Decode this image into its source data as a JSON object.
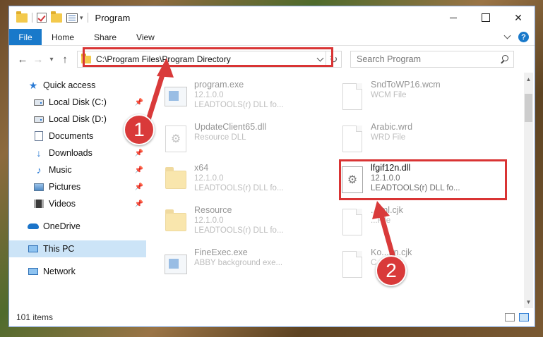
{
  "window": {
    "title": "Program",
    "icons": [
      "folder-icon",
      "properties-check-icon",
      "folder-icon",
      "properties-icon"
    ]
  },
  "ribbon": {
    "tabs": [
      "File",
      "Home",
      "Share",
      "View"
    ]
  },
  "address": {
    "path": "C:\\Program Files\\Program Directory",
    "refresh_icon": "refresh-icon"
  },
  "search": {
    "placeholder": "Search Program"
  },
  "sidebar": {
    "items": [
      {
        "label": "Quick access",
        "icon": "star-icon",
        "pinned": false
      },
      {
        "label": "Local Disk (C:)",
        "icon": "disk-icon",
        "pinned": true
      },
      {
        "label": "Local Disk (D:)",
        "icon": "disk-icon",
        "pinned": false
      },
      {
        "label": "Documents",
        "icon": "documents-icon",
        "pinned": true
      },
      {
        "label": "Downloads",
        "icon": "downloads-icon",
        "pinned": true
      },
      {
        "label": "Music",
        "icon": "music-icon",
        "pinned": true
      },
      {
        "label": "Pictures",
        "icon": "pictures-icon",
        "pinned": true
      },
      {
        "label": "Videos",
        "icon": "videos-icon",
        "pinned": true
      },
      {
        "label": "OneDrive",
        "icon": "onedrive-icon",
        "pinned": false
      },
      {
        "label": "This PC",
        "icon": "pc-icon",
        "pinned": false,
        "selected": true
      },
      {
        "label": "Network",
        "icon": "network-icon",
        "pinned": false
      }
    ]
  },
  "files": [
    {
      "name": "program.exe",
      "line2": "12.1.0.0",
      "line3": "LEADTOOLS(r) DLL fo...",
      "icon": "exe-icon"
    },
    {
      "name": "SndToWP16.wcm",
      "line2": "WCM File",
      "line3": "",
      "icon": "page-icon"
    },
    {
      "name": "UpdateClient65.dll",
      "line2": "Resource DLL",
      "line3": "",
      "icon": "gears-icon"
    },
    {
      "name": "Arabic.wrd",
      "line2": "WRD File",
      "line3": "",
      "icon": "page-icon"
    },
    {
      "name": "x64",
      "line2": "12.1.0.0",
      "line3": "LEADTOOLS(r) DLL fo...",
      "icon": "folder-icon"
    },
    {
      "name": "lfgif12n.dll",
      "line2": "12.1.0.0",
      "line3": "LEADTOOLS(r) DLL fo...",
      "icon": "gears-icon"
    },
    {
      "name": "Resource",
      "line2": "12.1.0.0",
      "line3": "LEADTOOLS(r) DLL fo...",
      "icon": "folder-icon"
    },
    {
      "name": "...tml.cjk",
      "line2": "...File",
      "line3": "",
      "icon": "page-icon"
    },
    {
      "name": "FineExec.exe",
      "line2": "ABBY background exe...",
      "line3": "",
      "icon": "exe-icon"
    },
    {
      "name": "Ko...an.cjk",
      "line2": "C...",
      "line3": "",
      "icon": "page-icon"
    }
  ],
  "status": {
    "count": "101 items"
  },
  "annotations": {
    "badge1": "1",
    "badge2": "2",
    "color": "#d93a3a"
  }
}
